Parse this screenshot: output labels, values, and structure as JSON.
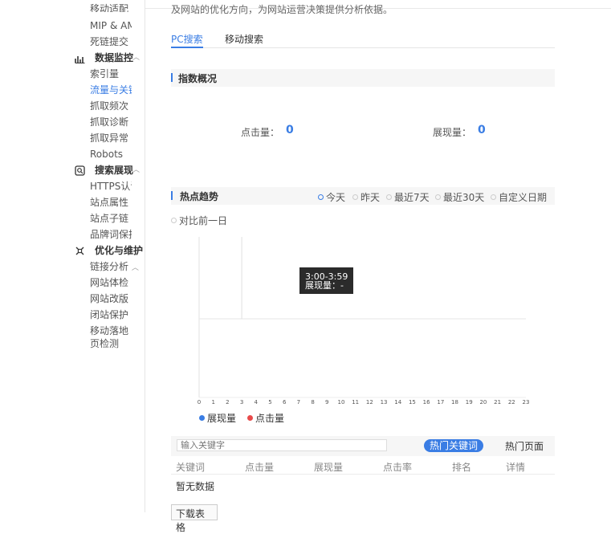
{
  "sidebar": {
    "items_top": [
      "移动适配",
      "MIP & AMP",
      "死链提交"
    ],
    "group_monitor": {
      "label": "数据监控",
      "items": [
        "索引量",
        "流量与关键词",
        "抓取频次",
        "抓取诊断",
        "抓取异常",
        "Robots"
      ]
    },
    "group_search": {
      "label": "搜索展现",
      "items": [
        "HTTPS认证",
        "站点属性",
        "站点子链",
        "品牌词保护"
      ]
    },
    "group_optimize": {
      "label": "优化与维护",
      "items": [
        "链接分析",
        "网站体检",
        "网站改版",
        "闭站保护",
        "移动落地页检测"
      ]
    }
  },
  "main": {
    "description": "及网站的优化方向，为网站运营决策提供分析依据。",
    "tabs": [
      "PC搜索",
      "移动搜索"
    ],
    "overview": {
      "title": "指数概况",
      "clicks_label": "点击量：",
      "clicks_value": "0",
      "impressions_label": "展现量：",
      "impressions_value": "0"
    },
    "hot_trend": {
      "title": "热点趋势",
      "ranges": [
        "今天",
        "昨天",
        "最近7天",
        "最近30天",
        "自定义日期"
      ],
      "selected_range": "今天",
      "compare": "对比前一日",
      "tooltip": {
        "time": "3:00-3:59",
        "line": "展现量：-"
      },
      "legend": [
        {
          "name": "展现量",
          "color": "#3a7de4"
        },
        {
          "name": "点击量",
          "color": "#e84a4a"
        }
      ]
    },
    "keywords": {
      "placeholder": "输入关键字",
      "tab_active": "热门关键词",
      "tab_other": "热门页面",
      "columns": [
        "关键词",
        "点击量",
        "展现量",
        "点击率",
        "排名",
        "详情"
      ],
      "empty": "暂无数据",
      "download": "下载表格"
    }
  },
  "chart_data": {
    "type": "line",
    "categories": [
      "0",
      "1",
      "2",
      "3",
      "4",
      "5",
      "6",
      "7",
      "8",
      "9",
      "10",
      "11",
      "12",
      "13",
      "14",
      "15",
      "16",
      "17",
      "18",
      "19",
      "20",
      "21",
      "22",
      "23"
    ],
    "series": [
      {
        "name": "展现量",
        "values": []
      },
      {
        "name": "点击量",
        "values": []
      }
    ],
    "grid": true,
    "legend_position": "bottom-left"
  }
}
